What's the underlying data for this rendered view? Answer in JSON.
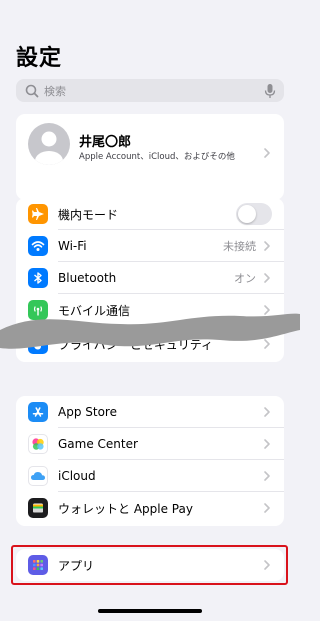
{
  "page": {
    "title": "設定"
  },
  "search": {
    "placeholder": "検索"
  },
  "profile": {
    "name": "井尾〇郎",
    "subtitle": "Apple Account、iCloud、およびその他"
  },
  "group1": [
    {
      "label": "機内モード",
      "icon": "airplane-icon",
      "icon_color": "#ff9500",
      "toggle": false
    },
    {
      "label": "Wi-Fi",
      "value": "未接続",
      "icon": "wifi-icon",
      "icon_color": "#007aff"
    },
    {
      "label": "Bluetooth",
      "value": "オン",
      "icon": "bluetooth-icon",
      "icon_color": "#007aff"
    },
    {
      "label": "モバイル通信",
      "icon": "cellular-icon",
      "icon_color": "#34c759"
    },
    {
      "label": "プライバシーとセキュリティ",
      "icon": "hand-icon",
      "icon_color": "#007aff"
    }
  ],
  "group2": [
    {
      "label": "App Store",
      "icon": "app-store-icon",
      "icon_color": "#1c8cf5"
    },
    {
      "label": "Game Center",
      "icon": "game-center-icon"
    },
    {
      "label": "iCloud",
      "icon": "icloud-icon"
    },
    {
      "label": "ウォレットと Apple Pay",
      "icon": "wallet-icon",
      "icon_color": "#1c1c1e"
    }
  ],
  "group3": [
    {
      "label": "アプリ",
      "icon": "apps-grid-icon",
      "icon_color": "#5e5ce6"
    }
  ],
  "colors": {
    "background": "#f2f2f7",
    "highlight": "#d9121b",
    "accent": "#007aff"
  }
}
